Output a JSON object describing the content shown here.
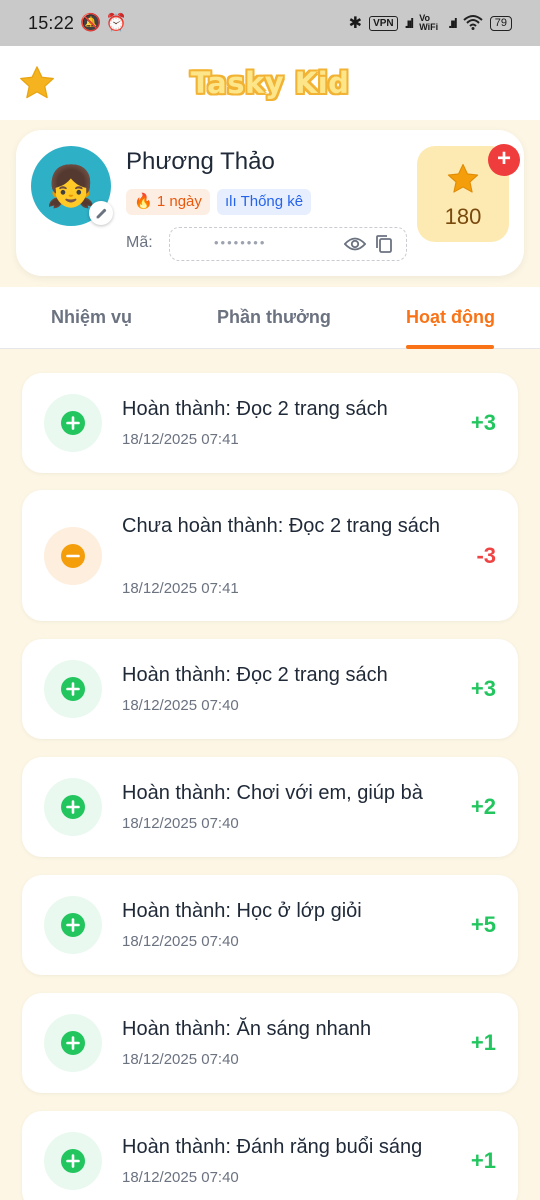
{
  "status_bar": {
    "time": "15:22",
    "left_icons": "🔕 ⏰",
    "bluetooth": "✱",
    "vpn": "VPN",
    "signal1": ".ııl",
    "vowifi": "Vo WiFi",
    "signal2": ".ııl",
    "battery": "79"
  },
  "header": {
    "title": "Tasky Kid"
  },
  "profile": {
    "name": "Phương Thảo",
    "streak": "🔥 1 ngày",
    "stats": "ılı Thống kê",
    "code_label": "Mã:",
    "code_value": "••••••••",
    "points": "180",
    "add": "+"
  },
  "tabs": [
    {
      "label": "Nhiệm vụ"
    },
    {
      "label": "Phần thưởng"
    },
    {
      "label": "Hoạt động",
      "active": true
    }
  ],
  "activities": [
    {
      "title": "Hoàn thành: Đọc 2 trang sách",
      "time": "18/12/2025 07:41",
      "points": "+3",
      "type": "plus"
    },
    {
      "title": "Chưa hoàn thành: Đọc 2 trang sách",
      "time": "18/12/2025 07:41",
      "points": "-3",
      "type": "minus"
    },
    {
      "title": "Hoàn thành: Đọc 2 trang sách",
      "time": "18/12/2025 07:40",
      "points": "+3",
      "type": "plus"
    },
    {
      "title": "Hoàn thành: Chơi với em, giúp bà",
      "time": "18/12/2025 07:40",
      "points": "+2",
      "type": "plus"
    },
    {
      "title": "Hoàn thành: Học ở lớp giỏi",
      "time": "18/12/2025 07:40",
      "points": "+5",
      "type": "plus"
    },
    {
      "title": "Hoàn thành: Ăn sáng nhanh",
      "time": "18/12/2025 07:40",
      "points": "+1",
      "type": "plus"
    },
    {
      "title": "Hoàn thành: Đánh răng buổi sáng",
      "time": "18/12/2025 07:40",
      "points": "+1",
      "type": "plus"
    }
  ],
  "colors": {
    "accent": "#f97316",
    "positive": "#22c55e",
    "negative": "#ef4444",
    "star": "#f5b41f"
  }
}
